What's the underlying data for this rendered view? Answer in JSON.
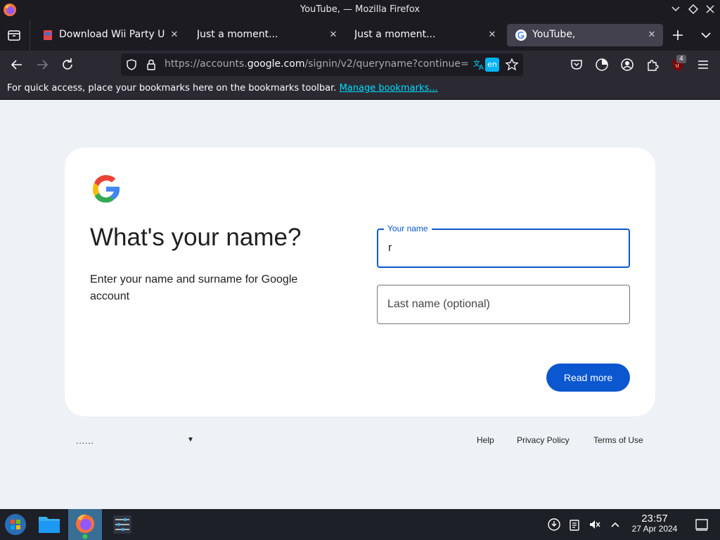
{
  "window": {
    "title": "YouTube, — Mozilla Firefox"
  },
  "tabs": [
    {
      "label": "Download Wii Party U RO",
      "active": false,
      "favicon": "rom-site-icon"
    },
    {
      "label": "Just a moment...",
      "active": false,
      "favicon": "none"
    },
    {
      "label": "Just a moment...",
      "active": false,
      "favicon": "none"
    },
    {
      "label": "YouTube,",
      "active": true,
      "favicon": "google-g-icon"
    }
  ],
  "navbar": {
    "url_prefix": "https://accounts.",
    "url_host": "google.com",
    "url_suffix": "/signin/v2/queryname?continue=",
    "translate_lang": "en",
    "extension_badge": "4"
  },
  "bookmarks_bar": {
    "message": "For quick access, place your bookmarks here on the bookmarks toolbar. ",
    "link": "Manage bookmarks..."
  },
  "signin": {
    "heading": "What's your name?",
    "subtext": "Enter your name and surname for Google account",
    "first_name_label": "Your name",
    "first_name_value": "r",
    "last_name_placeholder": "Last name (optional)",
    "next_button": "Read more"
  },
  "footer": {
    "language_value": "......",
    "help": "Help",
    "privacy": "Privacy Policy",
    "terms": "Terms of Use"
  },
  "taskbar": {
    "time": "23:57",
    "date": "27 Apr 2024"
  },
  "colors": {
    "google_blue": "#0b57d0",
    "page_bg": "#eef2f7",
    "firefox_dark": "#1c1b22",
    "toolbar": "#2b2a33"
  }
}
